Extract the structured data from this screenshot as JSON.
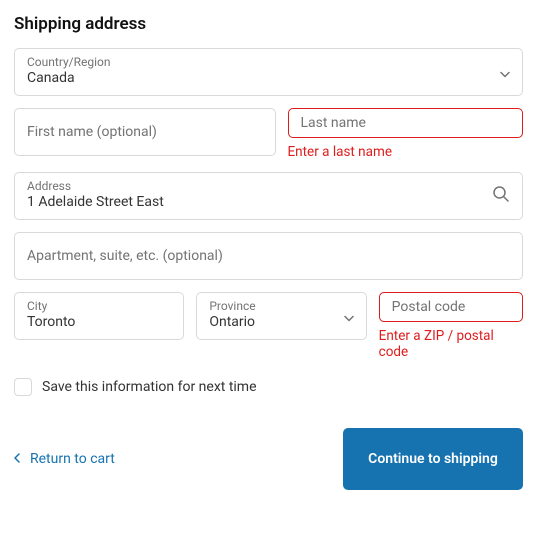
{
  "heading": "Shipping address",
  "country": {
    "label": "Country/Region",
    "value": "Canada"
  },
  "first_name": {
    "placeholder": "First name (optional)",
    "value": ""
  },
  "last_name": {
    "placeholder": "Last name",
    "value": "",
    "error": "Enter a last name"
  },
  "address": {
    "label": "Address",
    "value": "1 Adelaide Street East"
  },
  "apartment": {
    "placeholder": "Apartment, suite, etc. (optional)",
    "value": ""
  },
  "city": {
    "label": "City",
    "value": "Toronto"
  },
  "province": {
    "label": "Province",
    "value": "Ontario"
  },
  "postal": {
    "placeholder": "Postal code",
    "value": "",
    "error": "Enter a ZIP / postal code"
  },
  "save_checkbox": {
    "label": "Save this information for next time",
    "checked": false
  },
  "return_link": "Return to cart",
  "continue_button": "Continue to shipping"
}
